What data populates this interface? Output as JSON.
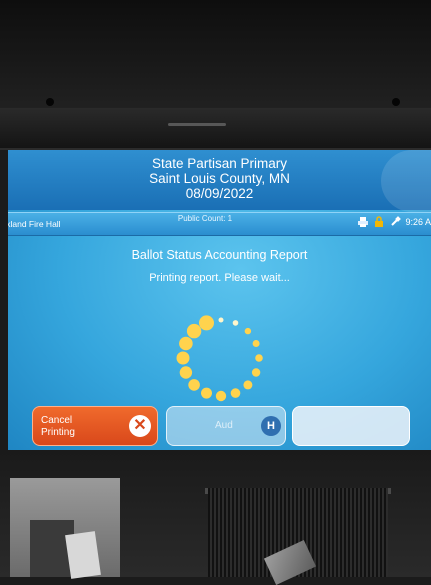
{
  "header": {
    "election_name": "State Partisan Primary",
    "jurisdiction": "Saint Louis County, MN",
    "date": "08/09/2022"
  },
  "status_bar": {
    "location": "xkland Fire Hall",
    "center_text": "Public Count: 1",
    "clock": "9:26 A",
    "tray_icons": [
      "printer-icon",
      "lock-icon",
      "power-plug-icon"
    ]
  },
  "main": {
    "title": "Ballot Status Accounting Report",
    "message": "Printing report. Please wait..."
  },
  "buttons": {
    "cancel_label": "Cancel Printing",
    "cancel_icon": "close-x-icon",
    "middle_label": "Aud",
    "middle_icon": "help-icon",
    "middle_icon_glyph": "H"
  },
  "colors": {
    "header": "#1a6fb5",
    "screen_bg": "#35a6dd",
    "cancel_button": "#e4541f",
    "spinner": "#ffd34d"
  }
}
